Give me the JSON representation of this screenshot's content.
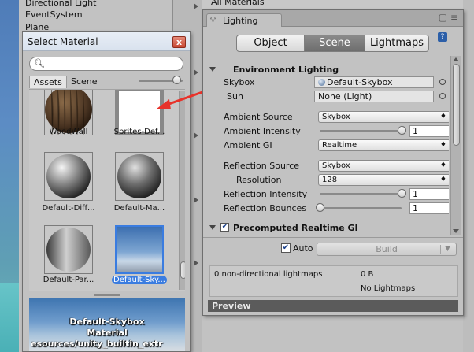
{
  "hierarchy": {
    "items": [
      "Directional Light",
      "EventSystem",
      "Plane"
    ]
  },
  "project": {
    "all_materials": "All Materials"
  },
  "select_material": {
    "title": "Select Material",
    "close_glyph": "x",
    "search": {
      "value": "",
      "placeholder": ""
    },
    "tabs": [
      "Assets",
      "Scene"
    ],
    "zoom": 0.85,
    "materials": [
      {
        "name": "WoodWall"
      },
      {
        "name": "Sprites-Def..."
      },
      {
        "name": "Default-Diff..."
      },
      {
        "name": "Default-Ma..."
      },
      {
        "name": "Default-Par..."
      },
      {
        "name": "Default-Sky...",
        "selected": true
      }
    ],
    "preview": {
      "name": "Default-Skybox",
      "type": "Material",
      "path": "esources/unity_builtin_extr"
    }
  },
  "lighting": {
    "tab_title": "Lighting",
    "modes": [
      "Object",
      "Scene",
      "Lightmaps"
    ],
    "active_mode": "Scene",
    "environment": {
      "title": "Environment Lighting",
      "skybox_label": "Skybox",
      "skybox_value": "Default-Skybox",
      "sun_label": "Sun",
      "sun_value": "None (Light)",
      "ambient_source_label": "Ambient Source",
      "ambient_source_value": "Skybox",
      "ambient_intensity_label": "Ambient Intensity",
      "ambient_intensity_value": "1",
      "ambient_intensity_fraction": 1.0,
      "ambient_gi_label": "Ambient GI",
      "ambient_gi_value": "Realtime",
      "reflection_source_label": "Reflection Source",
      "reflection_source_value": "Skybox",
      "resolution_label": "Resolution",
      "resolution_value": "128",
      "reflection_intensity_label": "Reflection Intensity",
      "reflection_intensity_value": "1",
      "reflection_intensity_fraction": 1.0,
      "reflection_bounces_label": "Reflection Bounces",
      "reflection_bounces_value": "1",
      "reflection_bounces_fraction": 0.0
    },
    "precomputed": {
      "title": "Precomputed Realtime GI",
      "enabled": true
    },
    "auto_label": "Auto",
    "auto_checked": true,
    "build_label": "Build",
    "stats": {
      "directional": "0 non-directional lightmaps",
      "size": "0 B",
      "no_lightmaps": "No Lightmaps"
    },
    "preview_label": "Preview"
  },
  "colors": {
    "selection": "#3a7ce0",
    "annotation_arrow": "#e8322a"
  }
}
